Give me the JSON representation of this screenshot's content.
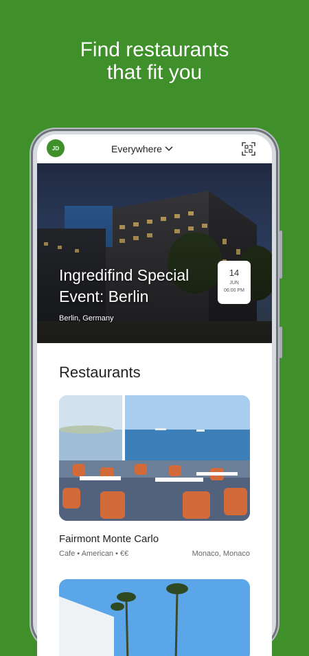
{
  "theme": {
    "background": "#3f8f2b",
    "accent": "#3f8f2b"
  },
  "promo": {
    "line1": "Find restaurants",
    "line2": "that fit you"
  },
  "topbar": {
    "avatar_initials": "JD",
    "location": "Everywhere",
    "location_icon": "chevron-down-icon",
    "scan_icon": "qr-scan-icon"
  },
  "event": {
    "title": "Ingredifind Special Event: Berlin",
    "location": "Berlin, Germany",
    "date_day": "14",
    "date_month": "JUN",
    "date_time": "06:00 PM"
  },
  "restaurants": {
    "heading": "Restaurants",
    "items": [
      {
        "name": "Fairmont Monte Carlo",
        "tags": "Cafe • American • €€",
        "location": "Monaco, Monaco"
      }
    ]
  }
}
